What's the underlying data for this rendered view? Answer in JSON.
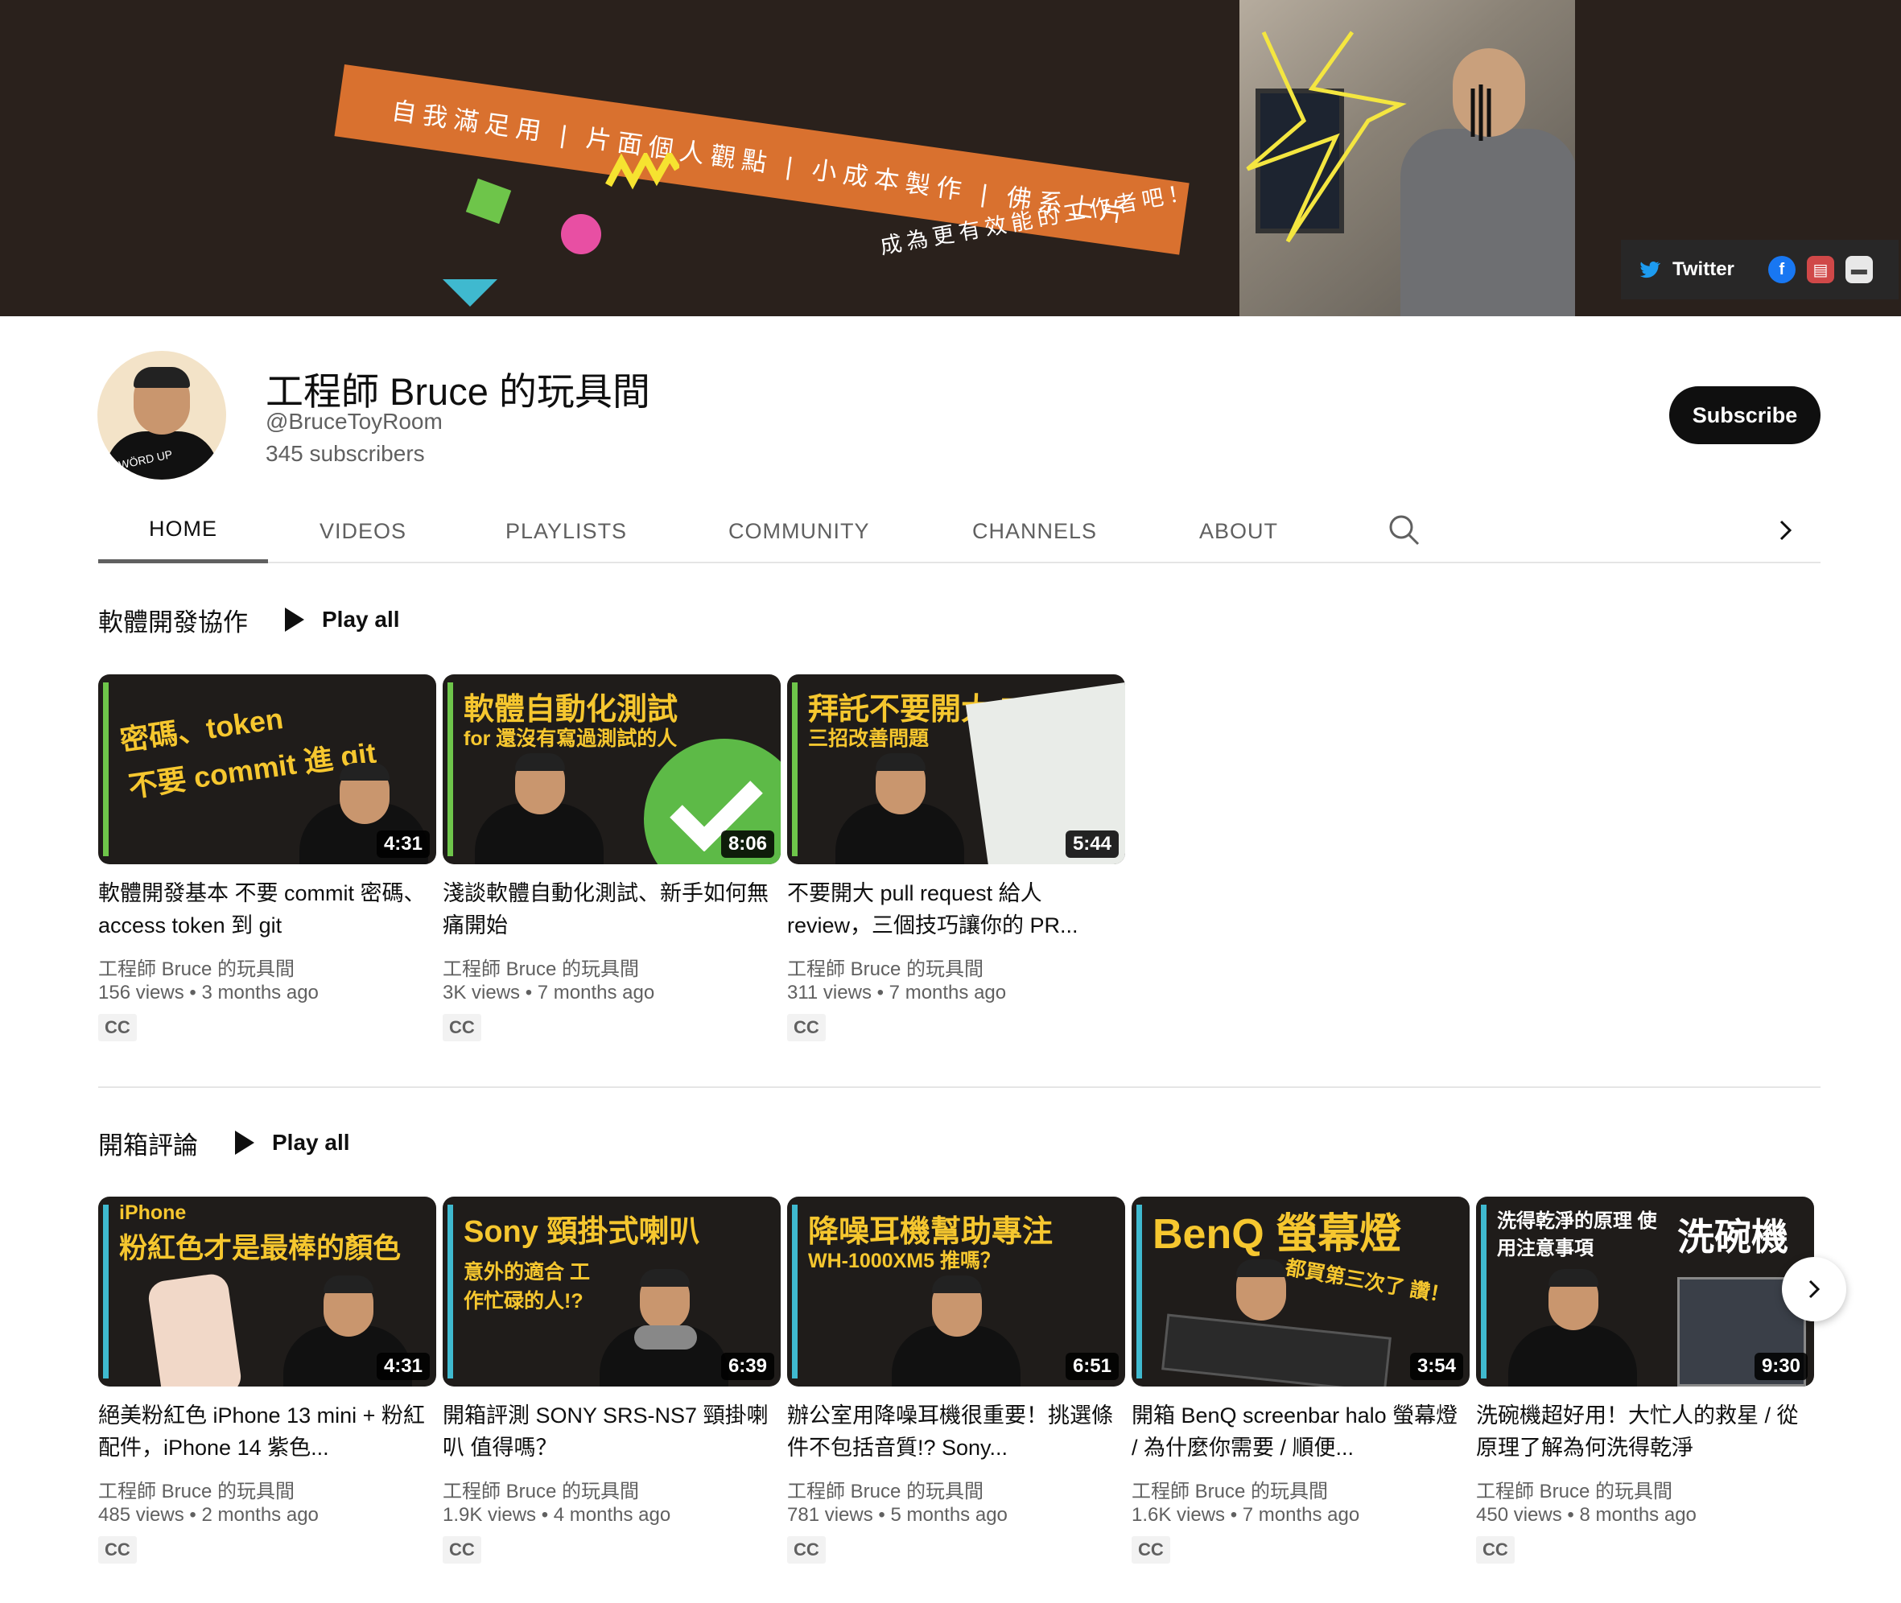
{
  "banner": {
    "ribbon_text": "自我滿足用 | 片面個人觀點 | 小成本製作 | 佛系上片",
    "tagline": "成為更有效能的工作者吧！",
    "links": {
      "twitter": "Twitter"
    }
  },
  "channel": {
    "avatar_text": "WÖRD UP",
    "title": "工程師 Bruce 的玩具間",
    "handle": "@BruceToyRoom",
    "subscribers": "345 subscribers",
    "subscribe_label": "Subscribe"
  },
  "tabs": [
    "HOME",
    "VIDEOS",
    "PLAYLISTS",
    "COMMUNITY",
    "CHANNELS",
    "ABOUT"
  ],
  "shelves": [
    {
      "title": "軟體開發協作",
      "play_all": "Play all",
      "videos": [
        {
          "thumb_line1": "密碼、token",
          "thumb_line2": "不要 commit 進 git",
          "duration": "4:31",
          "title": "軟體開發基本 不要 commit 密碼、access token 到 git",
          "channel": "工程師 Bruce 的玩具間",
          "meta": "156 views • 3 months ago",
          "cc": "CC",
          "accent": "#6ec54a"
        },
        {
          "thumb_line1": "軟體自動化測試",
          "thumb_line2": "for 還沒有寫過測試的人",
          "duration": "8:06",
          "title": "淺談軟體自動化測試、新手如何無痛開始",
          "channel": "工程師 Bruce 的玩具間",
          "meta": "3K views • 7 months ago",
          "cc": "CC",
          "accent": "#6ec54a"
        },
        {
          "thumb_line1": "拜託不要開大 PR",
          "thumb_line2": "三招改善問題",
          "duration": "5:44",
          "title": "不要開大 pull request 給人 review，三個技巧讓你的 PR...",
          "channel": "工程師 Bruce 的玩具間",
          "meta": "311 views • 7 months ago",
          "cc": "CC",
          "accent": "#6ec54a"
        }
      ]
    },
    {
      "title": "開箱評論",
      "play_all": "Play all",
      "videos": [
        {
          "thumb_line1": "iPhone",
          "thumb_line2": "粉紅色才是最棒的顏色",
          "duration": "4:31",
          "title": "絕美粉紅色 iPhone 13 mini + 粉紅配件，iPhone 14 紫色...",
          "channel": "工程師 Bruce 的玩具間",
          "meta": "485 views • 2 months ago",
          "cc": "CC",
          "accent": "#3fb9cf"
        },
        {
          "thumb_line1": "Sony 頸掛式喇叭",
          "thumb_line2": "意外的適合 工作忙碌的人!?",
          "duration": "6:39",
          "title": "開箱評測 SONY SRS-NS7 頸掛喇叭 值得嗎？",
          "channel": "工程師 Bruce 的玩具間",
          "meta": "1.9K views • 4 months ago",
          "cc": "CC",
          "accent": "#3fb9cf"
        },
        {
          "thumb_line1": "降噪耳機幫助專注",
          "thumb_line2": "WH-1000XM5 推嗎？",
          "duration": "6:51",
          "title": "辦公室用降噪耳機很重要！挑選條件不包括音質!? Sony...",
          "channel": "工程師 Bruce 的玩具間",
          "meta": "781 views • 5 months ago",
          "cc": "CC",
          "accent": "#3fb9cf"
        },
        {
          "thumb_line1": "BenQ 螢幕燈",
          "thumb_line2": "都買第三次了 讚！",
          "duration": "3:54",
          "title": "開箱 BenQ screenbar halo 螢幕燈 / 為什麼你需要 / 順便...",
          "channel": "工程師 Bruce 的玩具間",
          "meta": "1.6K views • 7 months ago",
          "cc": "CC",
          "accent": "#3fb9cf"
        },
        {
          "thumb_line1": "洗碗機",
          "thumb_line2": "洗得乾淨的原理 使用注意事項",
          "duration": "9:30",
          "title": "洗碗機超好用！大忙人的救星 / 從原理了解為何洗得乾淨",
          "channel": "工程師 Bruce 的玩具間",
          "meta": "450 views • 8 months ago",
          "cc": "CC",
          "accent": "#3fb9cf"
        }
      ]
    }
  ],
  "icons": [
    "twitter-icon",
    "facebook-icon",
    "link-icon",
    "link-icon",
    "search-icon",
    "chevron-right-icon",
    "play-icon"
  ]
}
